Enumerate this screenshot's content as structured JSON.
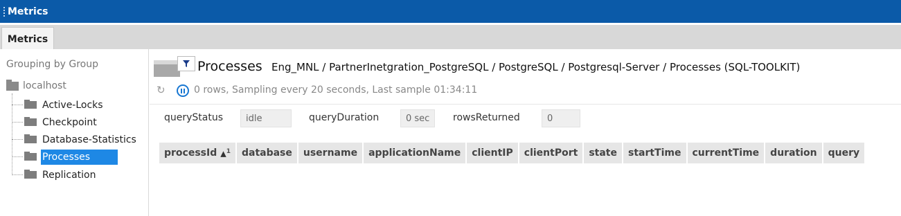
{
  "window": {
    "title": "Metrics"
  },
  "tabs": [
    {
      "label": "Metrics",
      "active": true
    }
  ],
  "sidebar": {
    "group_label": "Grouping by Group",
    "root": {
      "label": "localhost",
      "icon": "folder-icon"
    },
    "items": [
      {
        "label": "Active-Locks",
        "selected": false
      },
      {
        "label": "Checkpoint",
        "selected": false
      },
      {
        "label": "Database-Statistics",
        "selected": false
      },
      {
        "label": "Processes",
        "selected": true
      },
      {
        "label": "Replication",
        "selected": false
      }
    ]
  },
  "panel": {
    "title": "Processes",
    "breadcrumb": "Eng_MNL / PartnerInetgration_PostgreSQL / PostgreSQL / Postgresql-Server / Processes (SQL-TOOLKIT)",
    "status": "0 rows, Sampling every 20 seconds, Last sample 01:34:11"
  },
  "params": {
    "queryStatus": {
      "label": "queryStatus",
      "value": "idle"
    },
    "queryDuration": {
      "label": "queryDuration",
      "value": "0 sec"
    },
    "rowsReturned": {
      "label": "rowsReturned",
      "value": "0"
    }
  },
  "table": {
    "columns": [
      "processId",
      "database",
      "username",
      "applicationName",
      "clientIP",
      "clientPort",
      "state",
      "startTime",
      "currentTime",
      "duration",
      "query"
    ],
    "sort": {
      "column": "processId",
      "direction": "ascending",
      "order": "1"
    },
    "rows": []
  },
  "colors": {
    "titlebar": "#0b5aa8",
    "selection": "#1e88e5",
    "accent": "#1877d2"
  }
}
